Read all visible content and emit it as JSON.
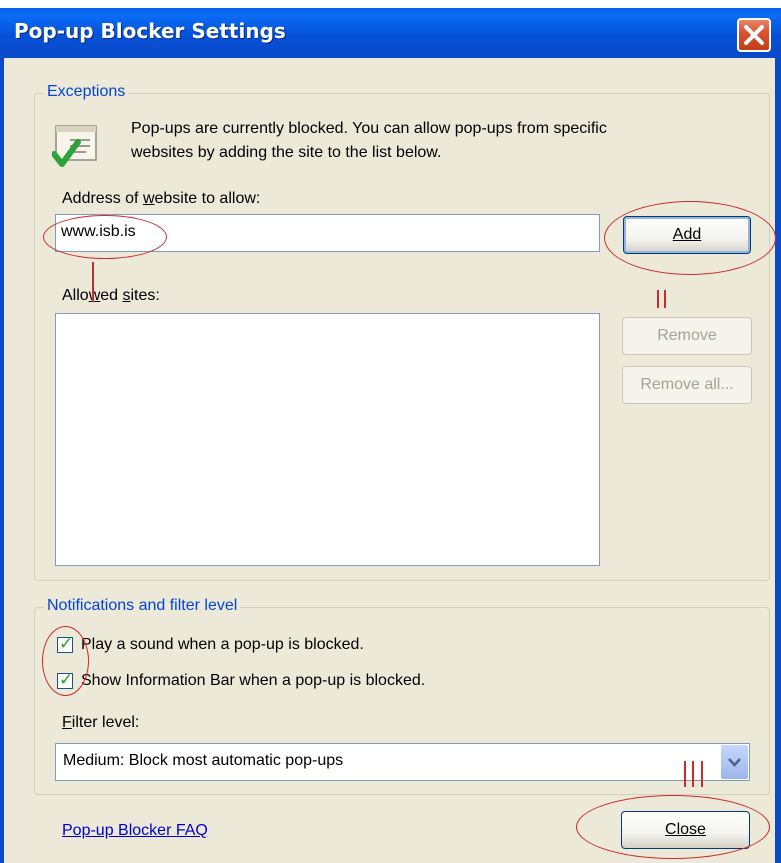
{
  "window": {
    "title": "Pop-up Blocker Settings",
    "close_icon": "close-x-icon"
  },
  "exceptions": {
    "legend": "Exceptions",
    "info_line1": "Pop-ups are currently blocked.  You can allow pop-ups from specific",
    "info_line2": "websites by adding the site to the list below.",
    "address_label": "Address of website to allow:",
    "address_value": "www.isb.is",
    "add_button": "Add",
    "allowed_label": "Allowed sites:",
    "allowed_sites": [],
    "remove_button": "Remove",
    "remove_all_button": "Remove all..."
  },
  "notifications": {
    "legend": "Notifications and filter level",
    "play_sound": {
      "label": "Play a sound when a pop-up is blocked.",
      "checked": true
    },
    "info_bar": {
      "label": "Show Information Bar when a pop-up is blocked.",
      "checked": true
    },
    "filter_label": "Filter level:",
    "filter_value": "Medium: Block most automatic pop-ups"
  },
  "footer": {
    "faq_link": "Pop-up Blocker FAQ",
    "close_button": "Close"
  },
  "annotations": {
    "marks": [
      "I",
      "II",
      "III"
    ],
    "color": "#cc2b2b"
  }
}
